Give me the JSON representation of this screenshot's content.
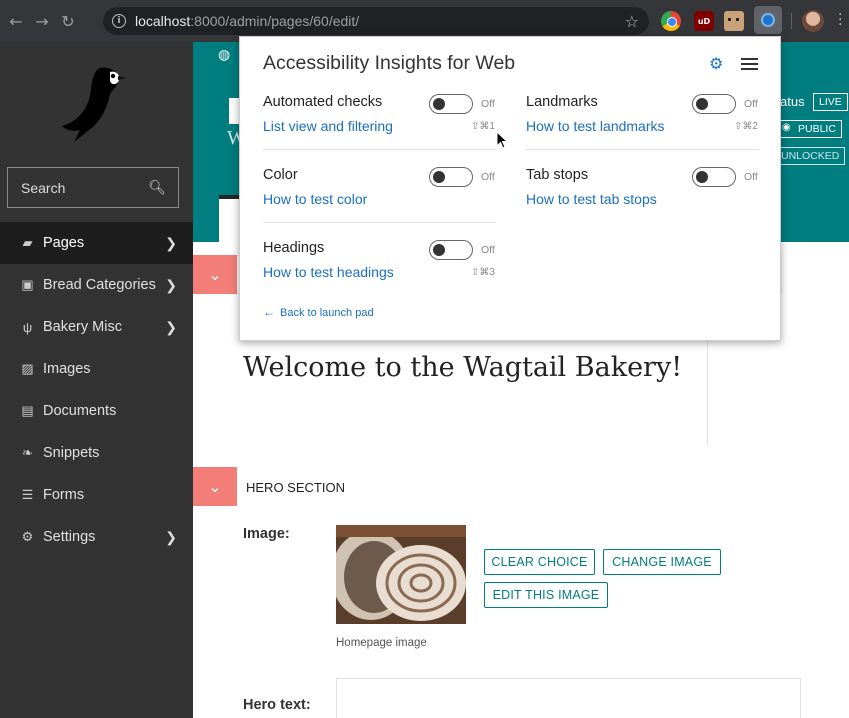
{
  "browser": {
    "url_host": "localhost",
    "url_rest": ":8000/admin/pages/60/edit/",
    "extensions": [
      "colorful-extension-icon",
      "ublock-icon",
      "pixel-face-icon",
      "accessibility-insights-icon"
    ]
  },
  "sidebar": {
    "search_placeholder": "Search",
    "items": [
      {
        "label": "Pages",
        "icon": "folder-open-icon",
        "has_submenu": true,
        "active": true
      },
      {
        "label": "Bread Categories",
        "icon": "suitcase-icon",
        "has_submenu": true,
        "active": false
      },
      {
        "label": "Bakery Misc",
        "icon": "cutlery-icon",
        "has_submenu": true,
        "active": false
      },
      {
        "label": "Images",
        "icon": "image-icon",
        "has_submenu": false,
        "active": false
      },
      {
        "label": "Documents",
        "icon": "doc-icon",
        "has_submenu": false,
        "active": false
      },
      {
        "label": "Snippets",
        "icon": "snippet-icon",
        "has_submenu": false,
        "active": false
      },
      {
        "label": "Forms",
        "icon": "form-icon",
        "has_submenu": false,
        "active": false
      },
      {
        "label": "Settings",
        "icon": "cogs-icon",
        "has_submenu": true,
        "active": false
      }
    ]
  },
  "header": {
    "letter": "W",
    "status_label": "atus",
    "badge_live": "LIVE",
    "badge_public": "PUBLIC",
    "badge_unlocked": "UNLOCKED"
  },
  "content": {
    "title_value": "Welcome to the Wagtail Bakery!",
    "hero_section_title": "HERO SECTION",
    "image_label": "Image:",
    "clear_choice": "CLEAR CHOICE",
    "change_image": "CHANGE IMAGE",
    "edit_image": "EDIT THIS IMAGE",
    "image_caption": "Homepage image",
    "hero_text_label": "Hero text:"
  },
  "popup": {
    "title": "Accessibility Insights for Web",
    "off": "Off",
    "tests": {
      "automated": {
        "name": "Automated checks",
        "link": "List view and filtering",
        "shortcut": "⇧⌘1"
      },
      "landmarks": {
        "name": "Landmarks",
        "link": "How to test landmarks",
        "shortcut": "⇧⌘2"
      },
      "color": {
        "name": "Color",
        "link": "How to test color"
      },
      "tabstops": {
        "name": "Tab stops",
        "link": "How to test tab stops"
      },
      "headings": {
        "name": "Headings",
        "link": "How to test headings",
        "shortcut": "⇧⌘3"
      }
    },
    "back_link": "Back to launch pad"
  },
  "colors": {
    "teal": "#007d7e",
    "sidebar": "#333333",
    "collapse_salmon": "#f37e77",
    "link_blue": "#1a6fbf"
  }
}
